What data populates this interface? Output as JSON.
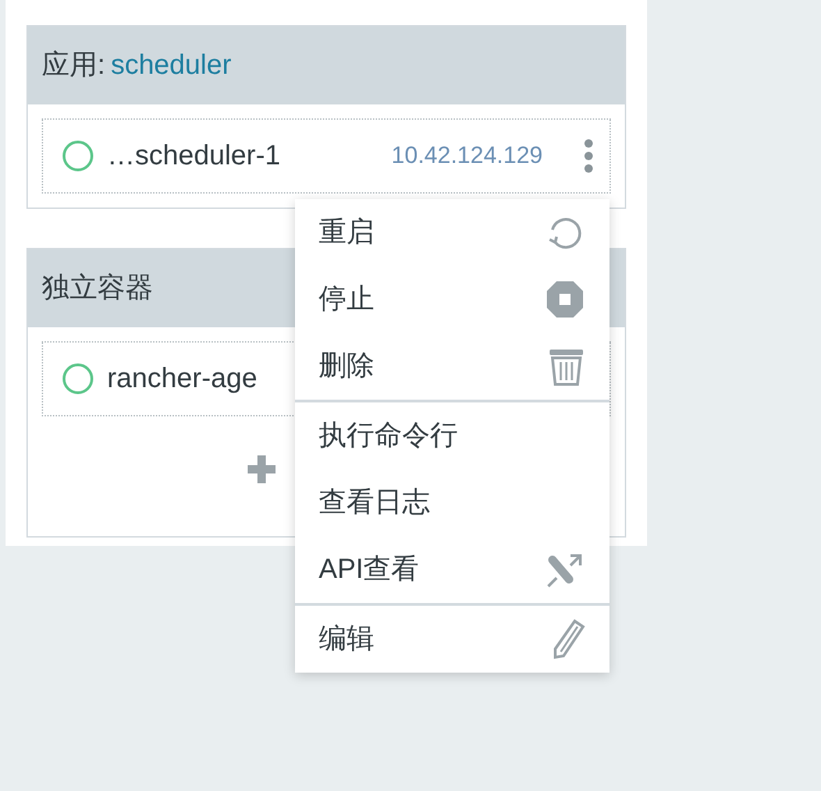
{
  "cards": [
    {
      "title_prefix": "应用:",
      "title_link": "scheduler",
      "rows": [
        {
          "name": "…scheduler-1",
          "ip": "10.42.124.129",
          "has_menu": true
        }
      ],
      "add_button": false
    },
    {
      "title_prefix": "独立容器",
      "rows": [
        {
          "name": "rancher-age"
        }
      ],
      "add_button": true
    }
  ],
  "menu": {
    "groups": [
      [
        {
          "label": "重启",
          "kind": "restart"
        },
        {
          "label": "停止",
          "kind": "stop"
        },
        {
          "label": "删除",
          "kind": "delete"
        }
      ],
      [
        {
          "label": "执行命令行"
        },
        {
          "label": "查看日志"
        },
        {
          "label": "API查看",
          "kind": "api"
        }
      ],
      [
        {
          "label": "编辑",
          "kind": "edit"
        }
      ]
    ]
  }
}
